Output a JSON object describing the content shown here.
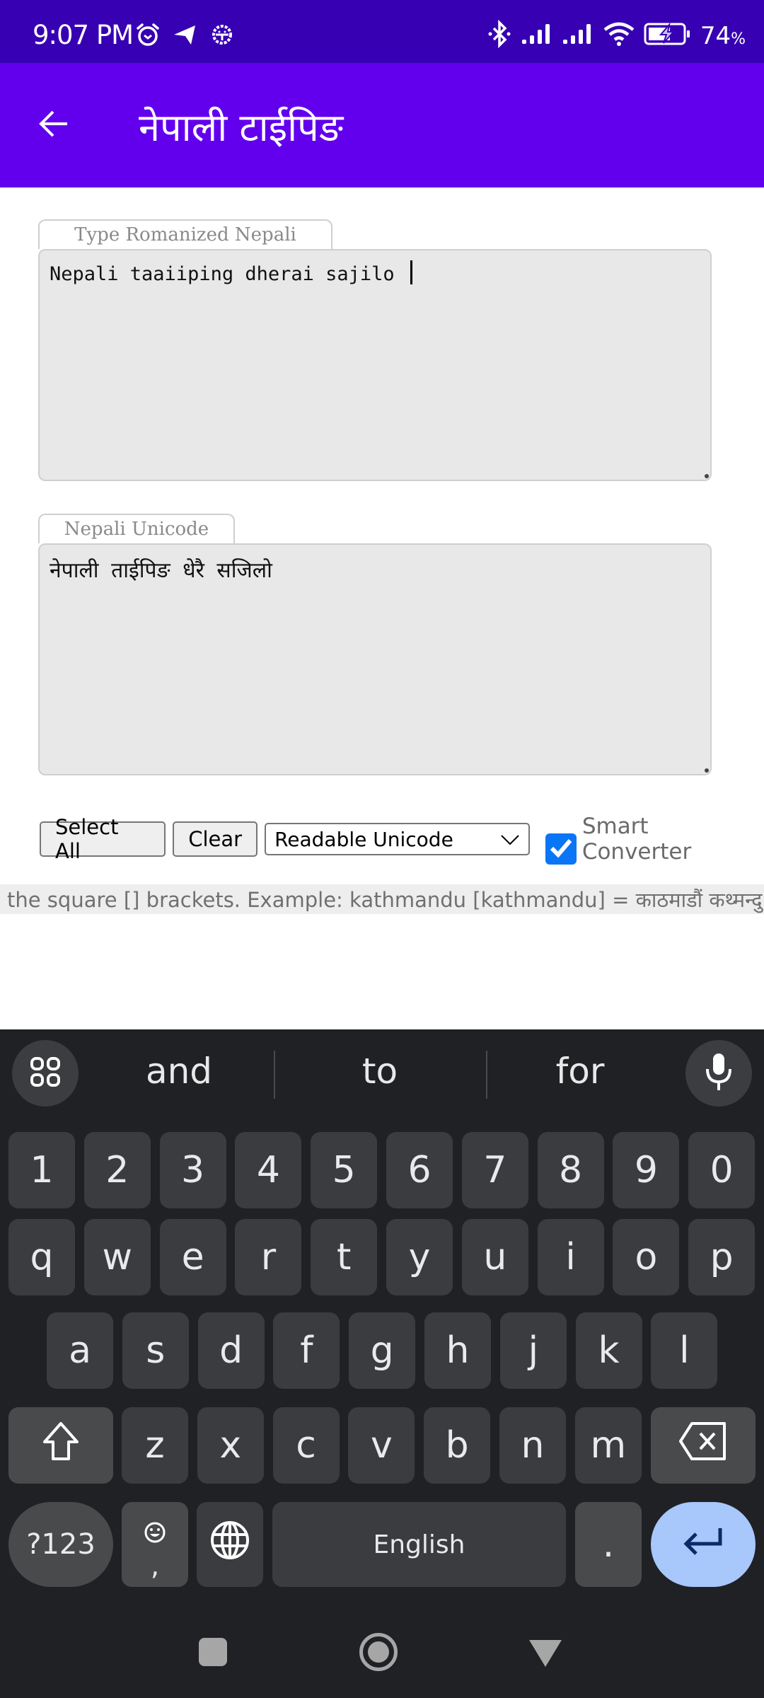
{
  "status_bar": {
    "time": "9:07 PM",
    "left_icons": [
      "alarm-icon",
      "telegram-icon",
      "android-debug-icon"
    ],
    "right_icons": [
      "bluetooth-icon",
      "signal-1-icon",
      "signal-2-icon",
      "wifi-icon",
      "battery-charging-icon"
    ],
    "battery_value": "74",
    "battery_unit": "%"
  },
  "app_bar": {
    "back_icon": "arrow-left-icon",
    "title": "नेपाली टाईपिङ",
    "color": "#6200ee",
    "status_color": "#3700b3"
  },
  "romanized": {
    "label": "Type Romanized Nepali",
    "value": "Nepali taaiiping dherai sajilo "
  },
  "unicode": {
    "label": "Nepali Unicode",
    "value": "नेपाली ताईपिङ धेरै सजिलो"
  },
  "controls": {
    "select_all_label": "Select All",
    "clear_label": "Clear",
    "format_select_value": "Readable Unicode",
    "smart_converter_label": "Smart Converter",
    "smart_converter_checked": true,
    "checkbox_color": "#0a76f6"
  },
  "marquee": {
    "text": "the square [] brackets. Example: kathmandu [kathmandu] = काठमाडौं कथ्मन्दु | के"
  },
  "keyboard": {
    "suggestions": [
      "and",
      "to",
      "for"
    ],
    "number_row": [
      "1",
      "2",
      "3",
      "4",
      "5",
      "6",
      "7",
      "8",
      "9",
      "0"
    ],
    "row1": [
      "q",
      "w",
      "e",
      "r",
      "t",
      "y",
      "u",
      "i",
      "o",
      "p"
    ],
    "row2": [
      "a",
      "s",
      "d",
      "f",
      "g",
      "h",
      "j",
      "k",
      "l"
    ],
    "row3": [
      "z",
      "x",
      "c",
      "v",
      "b",
      "n",
      "m"
    ],
    "symbols_label": "?123",
    "comma_label": ",",
    "space_label": "English",
    "period_label": ".",
    "enter_color": "#a8c7fa"
  }
}
